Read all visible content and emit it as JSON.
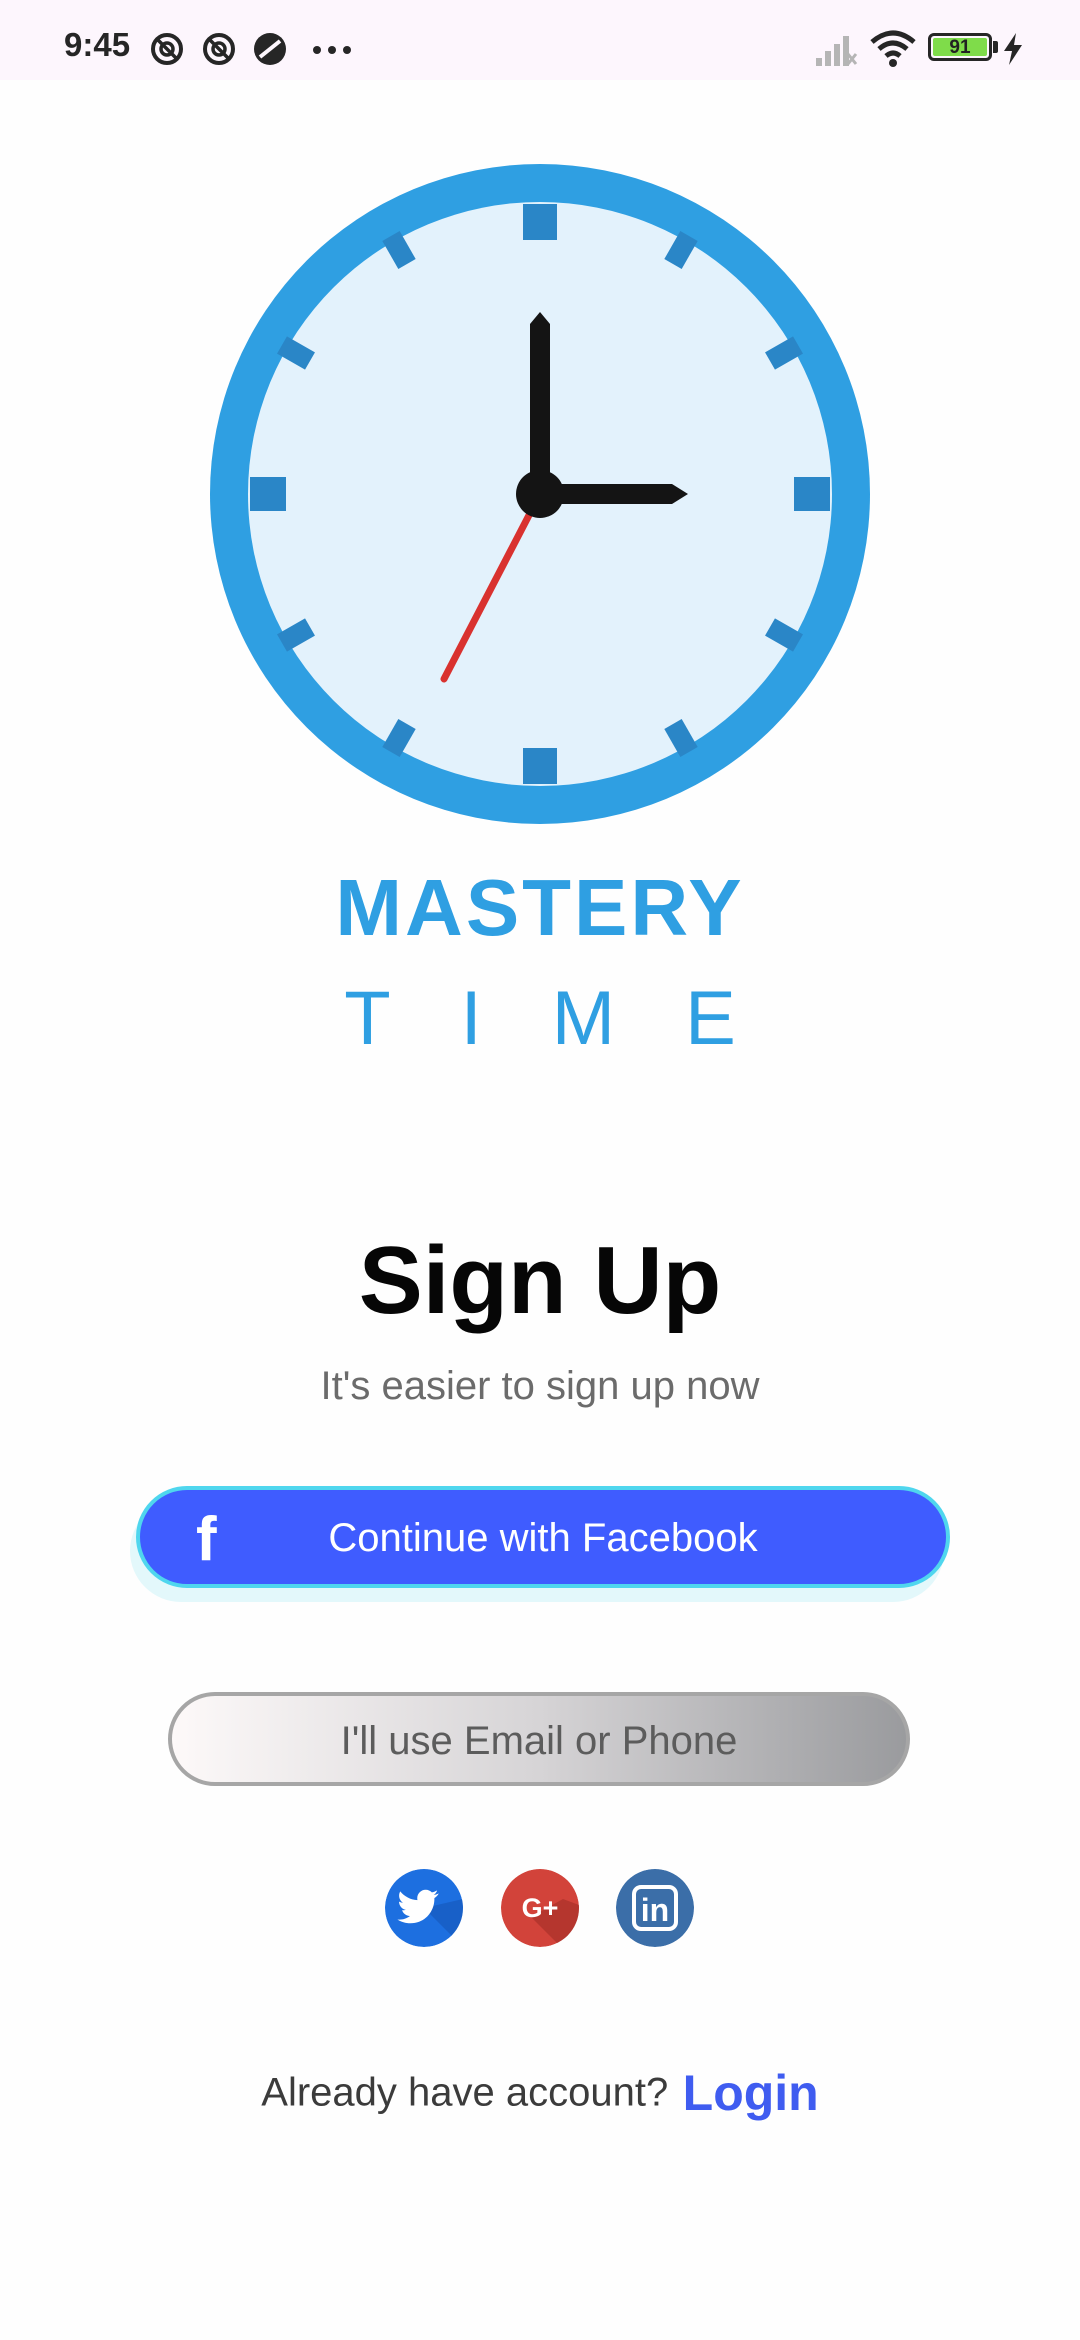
{
  "status_bar": {
    "time": "9:45",
    "battery_level": "91",
    "icons": [
      "do-not-disturb-icon",
      "do-not-disturb-icon",
      "vpn-icon",
      "more-dots-icon",
      "signal-icon",
      "wifi-icon",
      "battery-icon",
      "charging-icon"
    ]
  },
  "brand": {
    "title": "MASTERY",
    "subtitle": "TIME",
    "logo_icon": "clock-icon",
    "color": "#2f9fe2"
  },
  "signup": {
    "heading": "Sign Up",
    "subheading": "It's easier to sign up now",
    "facebook_label": "Continue with Facebook",
    "facebook_icon_glyph": "f",
    "email_label": "I'll use Email or Phone"
  },
  "social": {
    "items": [
      "twitter-icon",
      "google-plus-icon",
      "linkedin-icon"
    ],
    "google_glyph": "G+",
    "linkedin_glyph": "in"
  },
  "footer": {
    "prompt": "Already have account?",
    "login_label": "Login"
  },
  "colors": {
    "facebook_blue": "#3f5cff",
    "login_blue": "#3f5cf0",
    "clock_blue": "#2f9fe2",
    "twitter_blue": "#1d6fe0",
    "google_red": "#d2433a",
    "linkedin_blue": "#3b6ea8"
  }
}
